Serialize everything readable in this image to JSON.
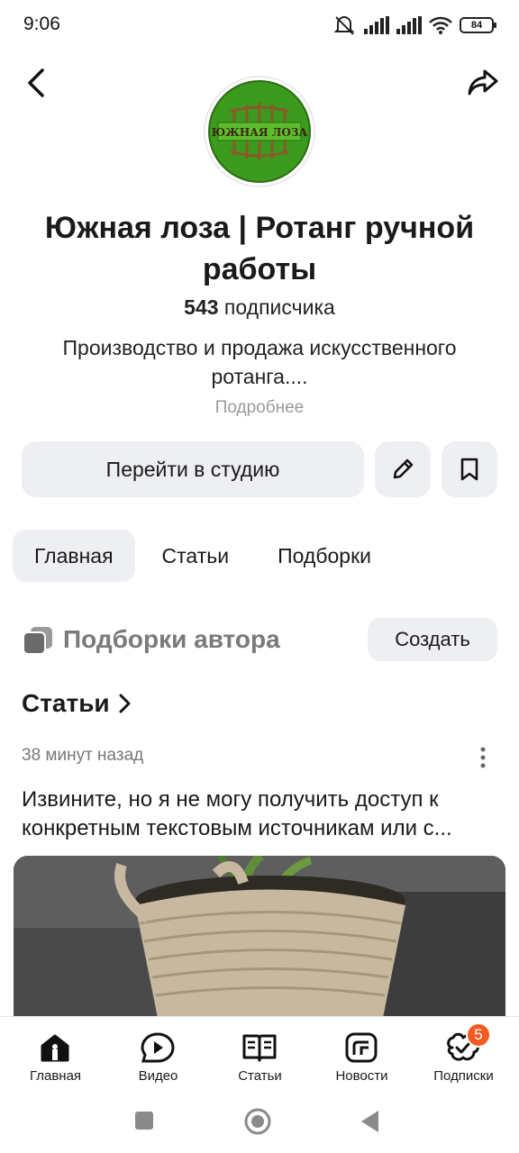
{
  "status_bar": {
    "time": "9:06",
    "battery": "84"
  },
  "header": {
    "logo_text": "ЮЖНАЯ ЛОЗА",
    "channel_title": "Южная лоза | Ротанг ручной работы",
    "subscribers_count": "543",
    "subscribers_label": "подписчика",
    "description": "Производство и продажа искусственного ротанга....",
    "more_link": "Подробнее"
  },
  "actions": {
    "studio_button": "Перейти в студию"
  },
  "tabs": [
    {
      "label": "Главная",
      "active": true
    },
    {
      "label": "Статьи",
      "active": false
    },
    {
      "label": "Подборки",
      "active": false
    }
  ],
  "collections": {
    "title": "Подборки автора",
    "create_button": "Создать"
  },
  "articles": {
    "heading": "Статьи",
    "post": {
      "time": "38 минут назад",
      "text": "Извините, но я не могу получить доступ к конкретным текстовым источникам или с..."
    }
  },
  "bottom_nav": [
    {
      "label": "Главная",
      "icon": "home-icon"
    },
    {
      "label": "Видео",
      "icon": "video-icon"
    },
    {
      "label": "Статьи",
      "icon": "articles-icon"
    },
    {
      "label": "Новости",
      "icon": "news-icon"
    },
    {
      "label": "Подписки",
      "icon": "subscriptions-icon",
      "badge": "5"
    }
  ],
  "colors": {
    "accent_badge": "#f35b23",
    "button_bg": "#eeeff2",
    "logo_green": "#3c9a1e"
  }
}
